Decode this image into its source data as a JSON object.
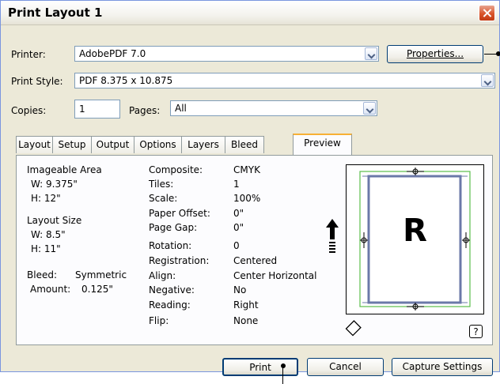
{
  "window": {
    "title": "Print Layout 1"
  },
  "printer": {
    "label": "Printer:",
    "value": "AdobePDF 7.0",
    "properties_label": "Properties..."
  },
  "print_style": {
    "label": "Print Style:",
    "value": "PDF 8.375 x 10.875"
  },
  "copies": {
    "label": "Copies:",
    "value": "1"
  },
  "pages": {
    "label": "Pages:",
    "value": "All"
  },
  "tabs": [
    "Layout",
    "Setup",
    "Output",
    "Options",
    "Layers",
    "Bleed",
    "Preview"
  ],
  "active_tab": "Preview",
  "info": {
    "imageable_area": "Imageable Area",
    "ia_w": "W: 9.375\"",
    "ia_h": "H: 12\"",
    "layout_size": "Layout Size",
    "ls_w": "W: 8.5\"",
    "ls_h": "H: 11\"",
    "bleed_label": "Bleed:",
    "bleed_value": "Symmetric",
    "amount_label": "Amount:",
    "amount_value": "0.125\""
  },
  "settings": [
    {
      "label": "Composite:",
      "value": "CMYK"
    },
    {
      "label": "Tiles:",
      "value": "1"
    },
    {
      "label": "Scale:",
      "value": "100%"
    },
    {
      "label": "Paper Offset:",
      "value": "0\""
    },
    {
      "label": "Page Gap:",
      "value": "0\""
    },
    {
      "label": "Rotation:",
      "value": "0"
    },
    {
      "label": "Registration:",
      "value": "Centered"
    },
    {
      "label": "Align:",
      "value": "Center Horizontal"
    },
    {
      "label": "Negative:",
      "value": "No"
    },
    {
      "label": "Reading:",
      "value": "Right"
    },
    {
      "label": "Flip:",
      "value": "None"
    }
  ],
  "preview": {
    "page_letter": "R",
    "help_label": "?"
  },
  "buttons": {
    "print": "Print",
    "cancel": "Cancel",
    "capture": "Capture Settings"
  },
  "colors": {
    "page_border": "#6b79a8",
    "bleed_guide": "#5bbd4a"
  }
}
